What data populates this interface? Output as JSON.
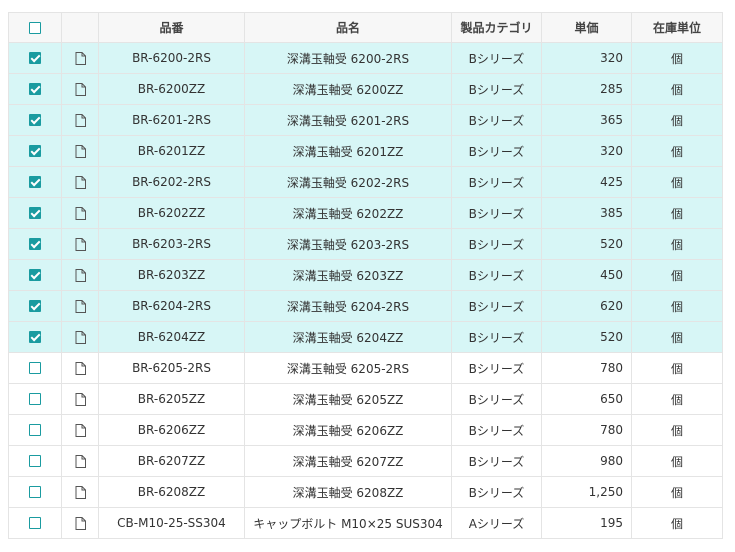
{
  "header": {
    "code": "品番",
    "name": "品名",
    "category": "製品カテゴリ",
    "price": "単価",
    "unit": "在庫単位"
  },
  "colors": {
    "accent": "#1a9ba0",
    "selected_row": "#d7f6f6",
    "border": "#e4e4e4"
  },
  "rows": [
    {
      "checked": true,
      "code": "BR-6200-2RS",
      "name": "深溝玉軸受 6200-2RS",
      "category": "Bシリーズ",
      "price": "320",
      "unit": "個"
    },
    {
      "checked": true,
      "code": "BR-6200ZZ",
      "name": "深溝玉軸受 6200ZZ",
      "category": "Bシリーズ",
      "price": "285",
      "unit": "個"
    },
    {
      "checked": true,
      "code": "BR-6201-2RS",
      "name": "深溝玉軸受 6201-2RS",
      "category": "Bシリーズ",
      "price": "365",
      "unit": "個"
    },
    {
      "checked": true,
      "code": "BR-6201ZZ",
      "name": "深溝玉軸受 6201ZZ",
      "category": "Bシリーズ",
      "price": "320",
      "unit": "個"
    },
    {
      "checked": true,
      "code": "BR-6202-2RS",
      "name": "深溝玉軸受 6202-2RS",
      "category": "Bシリーズ",
      "price": "425",
      "unit": "個"
    },
    {
      "checked": true,
      "code": "BR-6202ZZ",
      "name": "深溝玉軸受 6202ZZ",
      "category": "Bシリーズ",
      "price": "385",
      "unit": "個"
    },
    {
      "checked": true,
      "code": "BR-6203-2RS",
      "name": "深溝玉軸受 6203-2RS",
      "category": "Bシリーズ",
      "price": "520",
      "unit": "個"
    },
    {
      "checked": true,
      "code": "BR-6203ZZ",
      "name": "深溝玉軸受 6203ZZ",
      "category": "Bシリーズ",
      "price": "450",
      "unit": "個"
    },
    {
      "checked": true,
      "code": "BR-6204-2RS",
      "name": "深溝玉軸受 6204-2RS",
      "category": "Bシリーズ",
      "price": "620",
      "unit": "個"
    },
    {
      "checked": true,
      "code": "BR-6204ZZ",
      "name": "深溝玉軸受 6204ZZ",
      "category": "Bシリーズ",
      "price": "520",
      "unit": "個"
    },
    {
      "checked": false,
      "code": "BR-6205-2RS",
      "name": "深溝玉軸受 6205-2RS",
      "category": "Bシリーズ",
      "price": "780",
      "unit": "個"
    },
    {
      "checked": false,
      "code": "BR-6205ZZ",
      "name": "深溝玉軸受 6205ZZ",
      "category": "Bシリーズ",
      "price": "650",
      "unit": "個"
    },
    {
      "checked": false,
      "code": "BR-6206ZZ",
      "name": "深溝玉軸受 6206ZZ",
      "category": "Bシリーズ",
      "price": "780",
      "unit": "個"
    },
    {
      "checked": false,
      "code": "BR-6207ZZ",
      "name": "深溝玉軸受 6207ZZ",
      "category": "Bシリーズ",
      "price": "980",
      "unit": "個"
    },
    {
      "checked": false,
      "code": "BR-6208ZZ",
      "name": "深溝玉軸受 6208ZZ",
      "category": "Bシリーズ",
      "price": "1,250",
      "unit": "個"
    },
    {
      "checked": false,
      "code": "CB-M10-25-SS304",
      "name": "キャップボルト M10×25 SUS304",
      "category": "Aシリーズ",
      "price": "195",
      "unit": "個"
    }
  ]
}
